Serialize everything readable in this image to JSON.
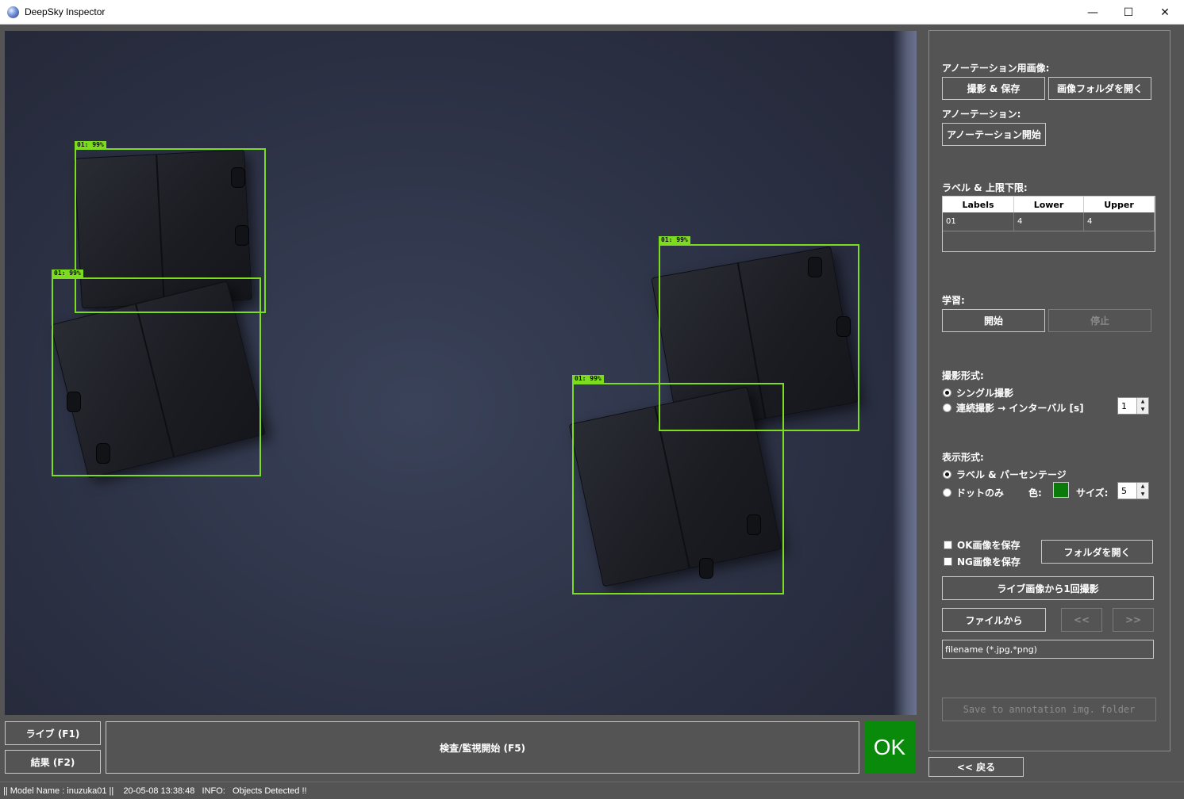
{
  "window": {
    "title": "DeepSky Inspector",
    "minimize_glyph": "—",
    "maximize_glyph": "☐",
    "close_glyph": "✕"
  },
  "detections": [
    {
      "label": "01:  99%"
    },
    {
      "label": "01:  99%"
    },
    {
      "label": "01:  99%"
    },
    {
      "label": "01:  99%"
    }
  ],
  "bottom": {
    "live_button": "ライブ (F1)",
    "result_button": "結果 (F2)",
    "inspect_button": "検査/監視開始 (F5)",
    "ok_status": "OK",
    "ok_color": "#0a8a0a"
  },
  "panel": {
    "annotation_image_label": "アノーテーション用画像:",
    "capture_save_button": "撮影 & 保存",
    "open_image_folder_button": "画像フォルダを開く",
    "annotation_label": "アノーテーション:",
    "annotation_start_button": "アノーテーション開始",
    "label_limits_label": "ラベル & 上限下限:",
    "table": {
      "headers": [
        "Labels",
        "Lower",
        "Upper"
      ],
      "rows": [
        [
          "01",
          "4",
          "4"
        ]
      ]
    },
    "training_label": "学習:",
    "train_start_button": "開始",
    "train_stop_button": "停止",
    "capture_mode_label": "撮影形式:",
    "single_capture": "シングル撮影",
    "continuous_capture": "連続撮影 → インターバル [s]",
    "interval_value": "1",
    "display_mode_label": "表示形式:",
    "label_percentage": "ラベル & パーセンテージ",
    "dot_only": "ドットのみ",
    "color_label": "色:",
    "dot_color": "#0a7a0a",
    "size_label": "サイズ:",
    "size_value": "5",
    "save_ok_images": "OK画像を保存",
    "save_ng_images": "NG画像を保存",
    "open_folder_button": "フォルダを開く",
    "capture_once_button": "ライブ画像から1回撮影",
    "from_file_button": "ファイルから",
    "prev_button": "<<",
    "next_button": ">>",
    "filename_placeholder": "filename (*.jpg,*png)",
    "save_annotation_button": "Save to annotation img. folder",
    "back_button": "<< 戻る"
  },
  "status": {
    "text": "|| Model Name : inuzuka01 ||    20-05-08 13:38:48   INFO:   Objects Detected !!"
  }
}
